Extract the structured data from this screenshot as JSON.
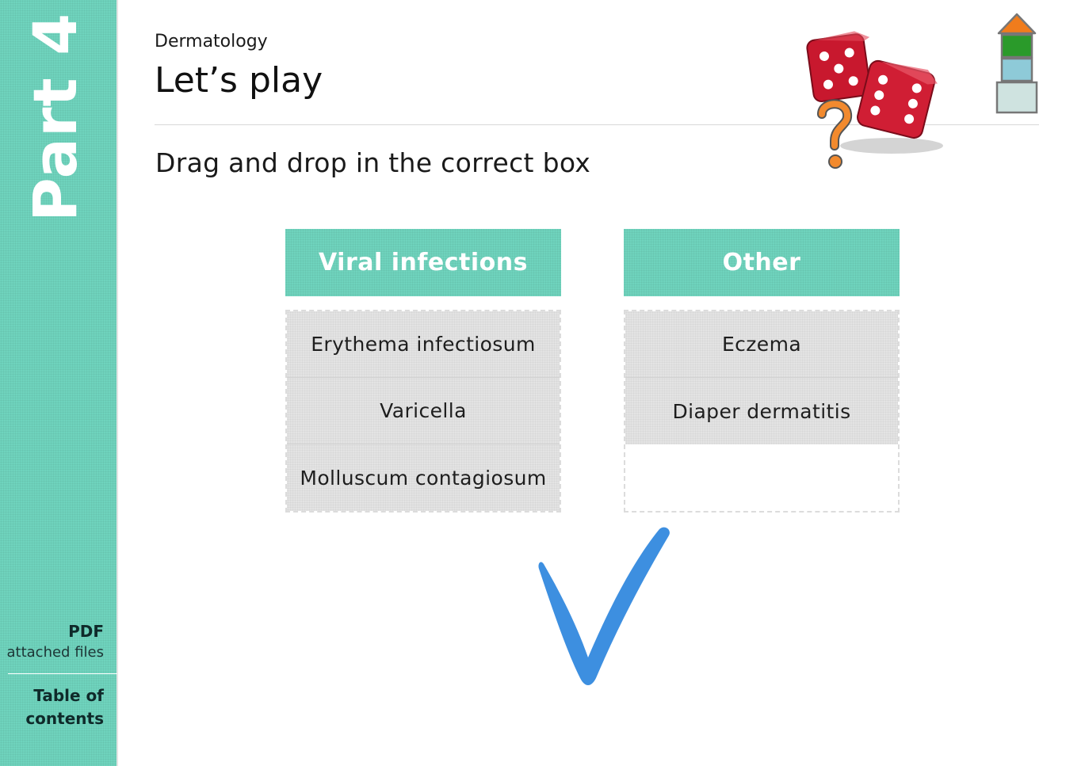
{
  "sidebar": {
    "part_label": "Part 4",
    "pdf_label": "PDF",
    "pdf_sublabel": "attached files",
    "toc_label": "Table of contents"
  },
  "header": {
    "subject": "Dermatology",
    "title": "Let’s play",
    "instruction": "Drag and drop in the correct box"
  },
  "columns": [
    {
      "header": "Viral infections",
      "items": [
        "Erythema infectiosum",
        "Varicella",
        "Molluscum contagiosum"
      ]
    },
    {
      "header": "Other",
      "items": [
        "Eczema",
        "Diaper dermatitis"
      ]
    }
  ],
  "feedback": {
    "icon": "checkmark-icon",
    "color": "#3d8fe0"
  },
  "colors": {
    "accent": "#6fd3bd",
    "tile": "#e3e3e3",
    "die": "#c8182e"
  },
  "icons": {
    "illustration": "dice-question-illustration",
    "home": "home-stack-icon"
  }
}
